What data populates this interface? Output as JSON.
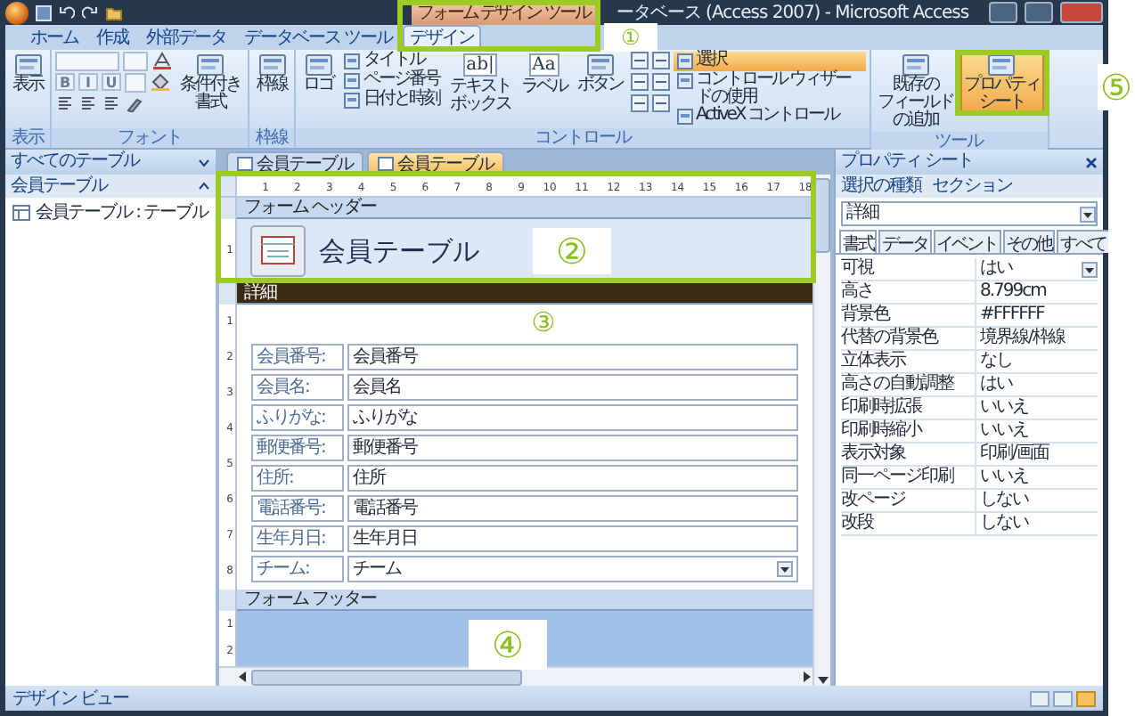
{
  "window": {
    "context_title": "フォーム デザイン ツール",
    "title": "ータベース (Access 2007) - Microsoft Access"
  },
  "ribbon_tabs": [
    {
      "label": "ホーム",
      "selected": false
    },
    {
      "label": "作成",
      "selected": false
    },
    {
      "label": "外部データ",
      "selected": false
    },
    {
      "label": "データベース ツール",
      "selected": false
    },
    {
      "label": "デザイン",
      "selected": true
    }
  ],
  "ribbon_groups": [
    {
      "label": "表示",
      "items": [
        {
          "kind": "large",
          "lines": [
            "表示"
          ],
          "selected": false
        }
      ]
    },
    {
      "label": "フォント",
      "items": [
        {
          "kind": "font-controls",
          "glyphs": [
            "B",
            "I",
            "U"
          ]
        },
        {
          "kind": "large",
          "lines": [
            "条件付き",
            "書式"
          ],
          "selected": false
        }
      ]
    },
    {
      "label": "枠線",
      "items": [
        {
          "kind": "large",
          "lines": [
            "枠線"
          ],
          "selected": false
        }
      ]
    },
    {
      "label": "コントロール",
      "items": [
        {
          "kind": "large",
          "lines": [
            "ロゴ"
          ],
          "selected": false
        },
        {
          "kind": "stack",
          "items": [
            {
              "label": "タイトル",
              "selected": false
            },
            {
              "label": "ページ番号",
              "selected": false
            },
            {
              "label": "日付と時刻",
              "selected": false
            }
          ]
        },
        {
          "kind": "large",
          "lines": [
            "テキスト",
            "ボックス"
          ],
          "glyph": "ab|",
          "selected": false
        },
        {
          "kind": "large",
          "lines": [
            "ラベル"
          ],
          "glyph": "Aa",
          "selected": false
        },
        {
          "kind": "large",
          "lines": [
            "ボタン"
          ],
          "selected": false
        },
        {
          "kind": "icon-grid"
        },
        {
          "kind": "stack",
          "items": [
            {
              "label": "選択",
              "selected": true
            },
            {
              "label": "コントロール ウィザードの使用",
              "selected": false
            },
            {
              "label": "ActiveX コントロール",
              "selected": false
            }
          ]
        }
      ]
    },
    {
      "label": "ツール",
      "items": [
        {
          "kind": "large",
          "lines": [
            "既存の",
            "フィールド",
            "の追加"
          ],
          "selected": false
        },
        {
          "kind": "large",
          "lines": [
            "プロパティ",
            "シート"
          ],
          "selected": true
        }
      ]
    }
  ],
  "nav_pane": {
    "header": "すべてのテーブル",
    "groups": [
      {
        "label": "会員テーブル",
        "expanded": true,
        "items": [
          "会員テーブル : テーブル"
        ]
      }
    ]
  },
  "document_tabs": [
    {
      "label": "会員テーブル",
      "selected": false
    },
    {
      "label": "会員テーブル",
      "selected": true
    }
  ],
  "ruler": [
    "1",
    "2",
    "3",
    "4",
    "5",
    "6",
    "7",
    "8",
    "9",
    "10",
    "11",
    "12",
    "13",
    "14",
    "15",
    "16",
    "17",
    "18"
  ],
  "form_header": {
    "bar": "フォーム ヘッダー",
    "title": "会員テーブル",
    "ruler": [
      "1"
    ]
  },
  "detail": {
    "bar": "詳細",
    "ruler": [
      "1",
      "2",
      "3",
      "4",
      "5",
      "6",
      "7",
      "8"
    ],
    "fields": [
      {
        "kind": "text",
        "label": "会員番号:",
        "value": "会員番号"
      },
      {
        "kind": "text",
        "label": "会員名:",
        "value": "会員名"
      },
      {
        "kind": "text",
        "label": "ふりがな:",
        "value": "ふりがな"
      },
      {
        "kind": "text",
        "label": "郵便番号:",
        "value": "郵便番号"
      },
      {
        "kind": "text",
        "label": "住所:",
        "value": "住所"
      },
      {
        "kind": "text",
        "label": "電話番号:",
        "value": "電話番号"
      },
      {
        "kind": "text",
        "label": "生年月日:",
        "value": "生年月日"
      },
      {
        "kind": "combo",
        "label": "チーム:",
        "value": "チーム"
      }
    ]
  },
  "form_footer": {
    "bar": "フォーム フッター",
    "ruler": [
      "1",
      "2"
    ]
  },
  "property_sheet": {
    "title": "プロパティ シート",
    "selection_label": "選択の種類",
    "selection_type": "セクション",
    "object": "詳細",
    "tabs": [
      {
        "label": "書式",
        "selected": true
      },
      {
        "label": "データ",
        "selected": false
      },
      {
        "label": "イベント",
        "selected": false
      },
      {
        "label": "その他",
        "selected": false
      },
      {
        "label": "すべて",
        "selected": false
      }
    ],
    "rows": [
      {
        "kind": "combo",
        "name": "可視",
        "value": "はい"
      },
      {
        "kind": "text",
        "name": "高さ",
        "value": "8.799cm"
      },
      {
        "kind": "text",
        "name": "背景色",
        "value": "#FFFFFF"
      },
      {
        "kind": "text",
        "name": "代替の背景色",
        "value": "境界線/枠線"
      },
      {
        "kind": "text",
        "name": "立体表示",
        "value": "なし"
      },
      {
        "kind": "text",
        "name": "高さの自動調整",
        "value": "はい"
      },
      {
        "kind": "text",
        "name": "印刷時拡張",
        "value": "いいえ"
      },
      {
        "kind": "text",
        "name": "印刷時縮小",
        "value": "いいえ"
      },
      {
        "kind": "text",
        "name": "表示対象",
        "value": "印刷/画面"
      },
      {
        "kind": "text",
        "name": "同一ページ印刷",
        "value": "いいえ"
      },
      {
        "kind": "text",
        "name": "改ページ",
        "value": "しない"
      },
      {
        "kind": "text",
        "name": "改段",
        "value": "しない"
      }
    ]
  },
  "status_bar": {
    "text": "デザイン ビュー",
    "views": [
      {
        "selected": false
      },
      {
        "selected": false
      },
      {
        "selected": true
      }
    ]
  },
  "annotations": [
    {
      "label": "①",
      "framed": true
    },
    {
      "label": "②",
      "framed": true
    },
    {
      "label": "③",
      "framed": false
    },
    {
      "label": "④",
      "framed": false
    },
    {
      "label": "⑤",
      "framed": true
    }
  ]
}
